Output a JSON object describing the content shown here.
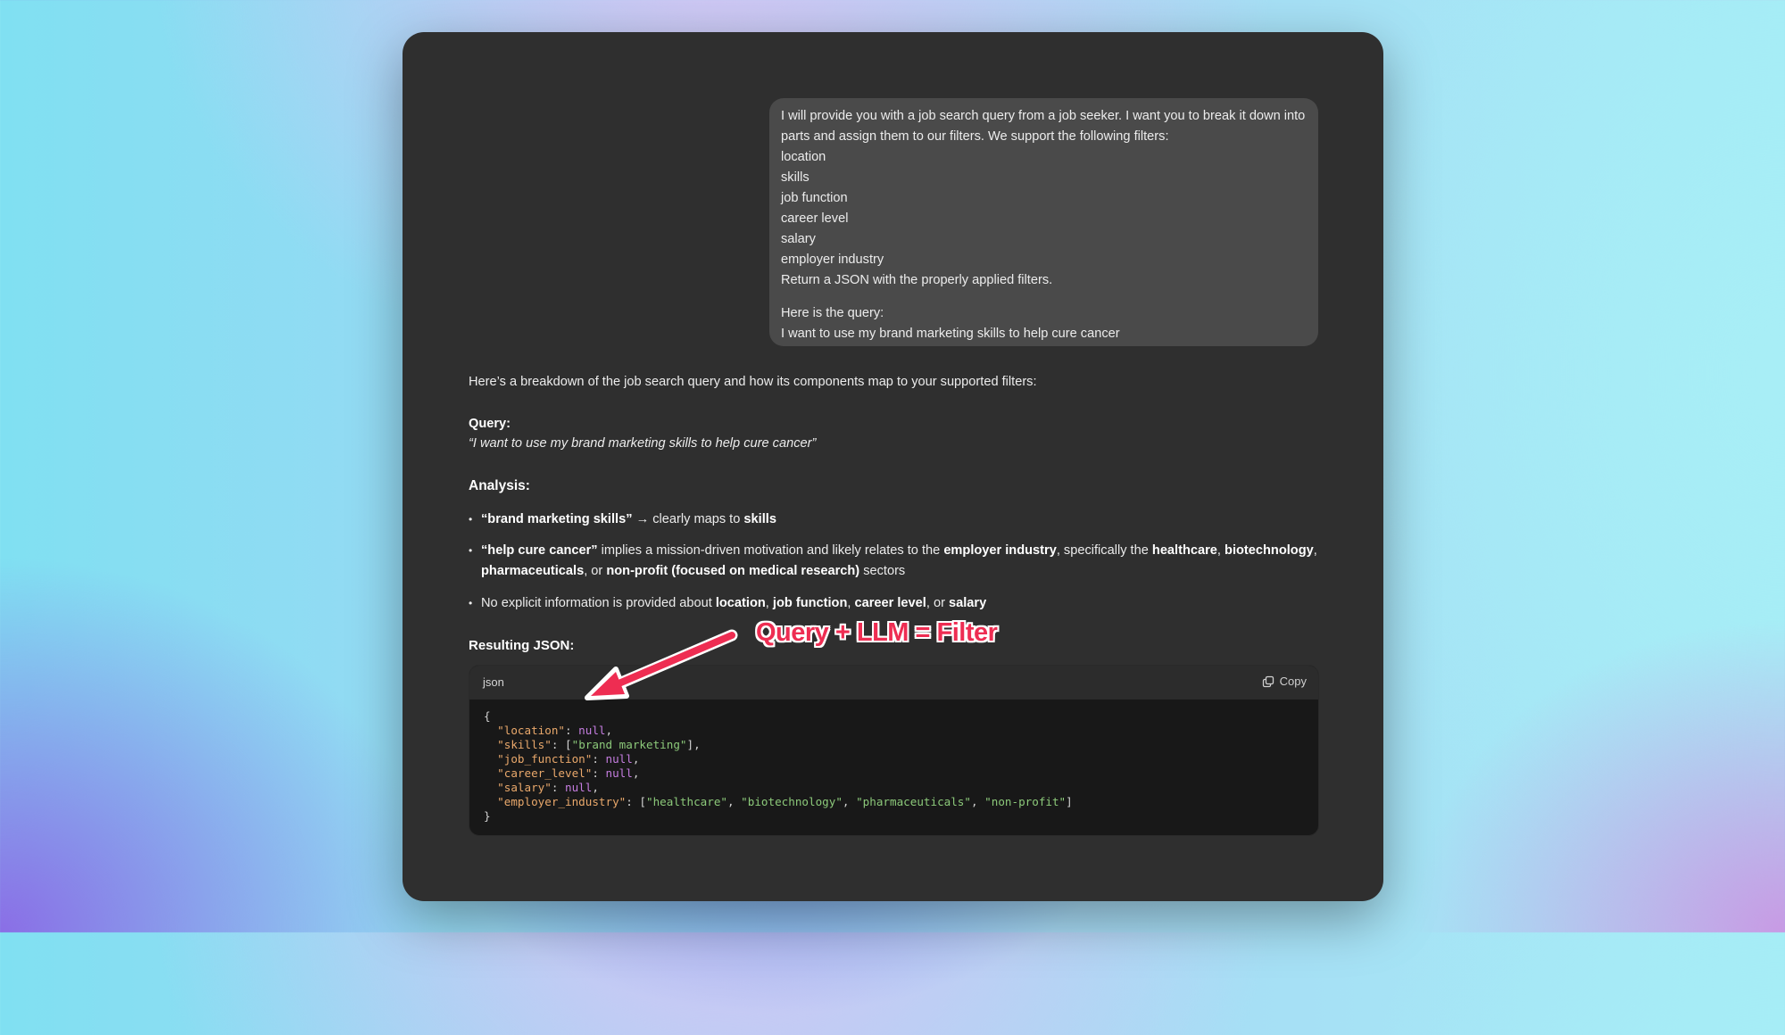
{
  "user_message": {
    "lines": [
      "I will provide you with a job search query from a job seeker. I want you to break it down into",
      "parts and assign them to our filters. We support the following filters:",
      "location",
      "skills",
      "job function",
      "career level",
      "salary",
      "employer industry",
      "Return a JSON with the properly applied filters."
    ],
    "query_intro": "Here is the query:",
    "query_text": "I want to use my brand marketing skills to help cure cancer"
  },
  "response": {
    "intro": "Here’s a breakdown of the job search query and how its components map to your supported filters:",
    "query_heading": "Query:",
    "query_quote": "“I want to use my brand marketing skills to help cure cancer”",
    "analysis_heading": "Analysis:",
    "bullet1": {
      "b1": "“brand marketing skills”",
      "t1": " → clearly maps to ",
      "b2": "skills"
    },
    "bullet2": {
      "b1": "“help cure cancer”",
      "t1": " implies a mission-driven motivation and likely relates to the ",
      "b2": "employer industry",
      "t2": ", specifically the ",
      "b3": "healthcare",
      "t3": ", ",
      "b4": "biotechnology",
      "t4": ",",
      "b5": "pharmaceuticals",
      "t5": ", or ",
      "b6": "non-profit (focused on medical research)",
      "t6": " sectors"
    },
    "bullet3": {
      "t1": "No explicit information is provided about ",
      "b1": "location",
      "t2": ", ",
      "b2": "job function",
      "t3": ", ",
      "b3": "career level",
      "t4": ", or ",
      "b4": "salary"
    },
    "json_heading": "Resulting JSON:"
  },
  "code_block": {
    "language": "json",
    "copy_label": "Copy",
    "open_brace": "{",
    "close_brace": "}",
    "fields": [
      {
        "key": "\"location\"",
        "value": "null",
        "kind": "null",
        "trail": ","
      },
      {
        "key": "\"skills\"",
        "value": "[\"brand marketing\"]",
        "kind": "string",
        "trail": ","
      },
      {
        "key": "\"job_function\"",
        "value": "null",
        "kind": "null",
        "trail": ","
      },
      {
        "key": "\"career_level\"",
        "value": "null",
        "kind": "null",
        "trail": ","
      },
      {
        "key": "\"salary\"",
        "value": "null",
        "kind": "null",
        "trail": ","
      },
      {
        "key": "\"employer_industry\"",
        "value": "[\"healthcare\", \"biotechnology\", \"pharmaceuticals\", \"non-profit\"]",
        "kind": "string",
        "trail": ""
      }
    ]
  },
  "annotation": {
    "text": "Query + LLM = Filter",
    "color": "#ee2d52"
  },
  "colors": {
    "window_bg": "#2f2f2f",
    "user_bubble_bg": "#4a4a4a",
    "code_bg": "#181818",
    "json_key": "#e9a86b",
    "json_string": "#8cc97a",
    "json_null": "#c57de0"
  }
}
